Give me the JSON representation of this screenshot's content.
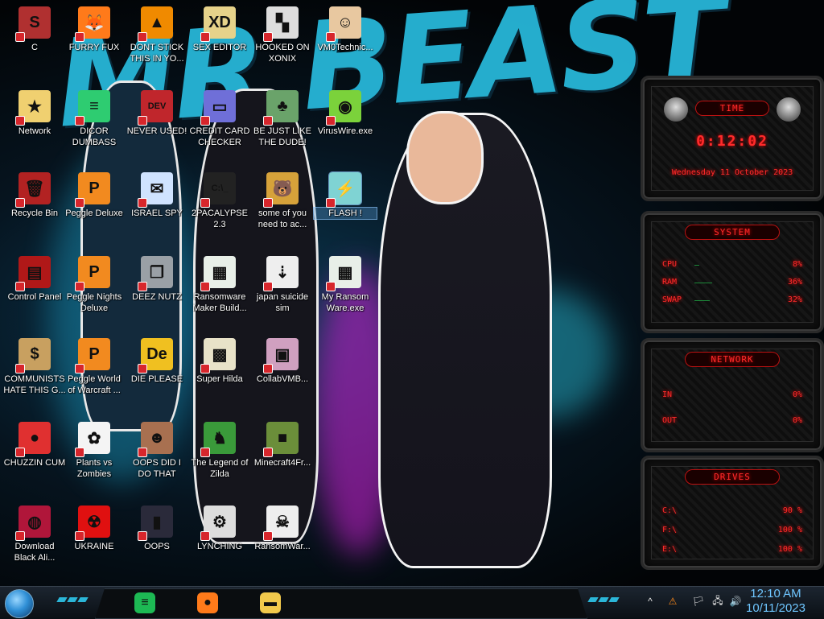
{
  "wallpaper": {
    "text": "MR BEAST"
  },
  "icons": [
    {
      "label": "C",
      "color": "#b03030",
      "glyph": "S"
    },
    {
      "label": "FURRY FUX",
      "color": "#ff7a1a",
      "glyph": "🦊"
    },
    {
      "label": "DONT STICK THIS IN YO...",
      "color": "#f08a00",
      "glyph": "▲"
    },
    {
      "label": "SEX EDITOR",
      "color": "#e6d28a",
      "glyph": "XD"
    },
    {
      "label": "HOOKED ON XONIX",
      "color": "#dddddd",
      "glyph": "▚"
    },
    {
      "label": "VM0Technic...",
      "color": "#e8c8a0",
      "glyph": "☺"
    },
    {
      "label": "Network",
      "color": "#f0d070",
      "glyph": "★"
    },
    {
      "label": "DICOR DUMBASS",
      "color": "#2ecc71",
      "glyph": "≡"
    },
    {
      "label": "NEVER USED!",
      "color": "#c0262c",
      "glyph": "DEV"
    },
    {
      "label": "CREDIT CARD CHECKER",
      "color": "#6f6fd8",
      "glyph": "▭"
    },
    {
      "label": "BE JUST LIKE THE DUDE!",
      "color": "#6aa36a",
      "glyph": "♣"
    },
    {
      "label": "VirusWire.exe",
      "color": "#7bd23b",
      "glyph": "◉"
    },
    {
      "label": "Recycle Bin",
      "color": "#b22222",
      "glyph": "🗑"
    },
    {
      "label": "Peggle Deluxe",
      "color": "#f28a1f",
      "glyph": "P"
    },
    {
      "label": "ISRAEL SPY",
      "color": "#cfe3ff",
      "glyph": "✉"
    },
    {
      "label": "2PACALYPSE 2.3",
      "color": "#222222",
      "glyph": "C:\\_"
    },
    {
      "label": "some of you need to ac...",
      "color": "#d6a23a",
      "glyph": "🐻"
    },
    {
      "label": "FLASH !",
      "color": "#7fd3d3",
      "glyph": "⚡"
    },
    {
      "label": "Control Panel",
      "color": "#b01818",
      "glyph": "▤"
    },
    {
      "label": "Peggle Nights Deluxe",
      "color": "#f28a1f",
      "glyph": "P"
    },
    {
      "label": "DEEZ NUTZ",
      "color": "#9aa0a6",
      "glyph": "❐"
    },
    {
      "label": "Ransomware Maker Build...",
      "color": "#e8efe8",
      "glyph": "▦"
    },
    {
      "label": "japan suicide sim",
      "color": "#eeeeee",
      "glyph": "⇣"
    },
    {
      "label": "My Ransom Ware.exe",
      "color": "#e8efe8",
      "glyph": "▦"
    },
    {
      "label": "COMMUNISTS HATE THIS G...",
      "color": "#c8a060",
      "glyph": "$"
    },
    {
      "label": "Peggle World of Warcraft ...",
      "color": "#f28a1f",
      "glyph": "P"
    },
    {
      "label": "DIE PLEASE",
      "color": "#f0c020",
      "glyph": "De"
    },
    {
      "label": "Super Hilda",
      "color": "#e8e2c8",
      "glyph": "▩"
    },
    {
      "label": "CollabVMB...",
      "color": "#d0a0c0",
      "glyph": "▣"
    },
    {
      "label": "CHUZZIN CUM",
      "color": "#e03030",
      "glyph": "●"
    },
    {
      "label": "Plants vs Zombies",
      "color": "#f4f4f4",
      "glyph": "✿"
    },
    {
      "label": "OOPS DID I DO THAT",
      "color": "#a87050",
      "glyph": "☻"
    },
    {
      "label": "The Legend of Zilda",
      "color": "#3a9a3a",
      "glyph": "♞"
    },
    {
      "label": "Minecraft4Fr...",
      "color": "#6b8e3a",
      "glyph": "■"
    },
    {
      "label": "Download Black Ali...",
      "color": "#b0163a",
      "glyph": "◍"
    },
    {
      "label": "UKRAINE",
      "color": "#e01010",
      "glyph": "☢"
    },
    {
      "label": "OOPS",
      "color": "#2a2a3a",
      "glyph": "▮"
    },
    {
      "label": "LYNCHING",
      "color": "#dddddd",
      "glyph": "⚙"
    },
    {
      "label": "RansomWar...",
      "color": "#eeeeee",
      "glyph": "☠"
    }
  ],
  "gadgets": {
    "time": {
      "header": "TIME",
      "clock": "0:12:02",
      "date": "Wednesday 11 October 2023"
    },
    "system": {
      "header": "SYSTEM",
      "rows": [
        {
          "label": "CPU",
          "value": "8%",
          "level": 0.08
        },
        {
          "label": "RAM",
          "value": "36%",
          "level": 0.36
        },
        {
          "label": "SWAP",
          "value": "32%",
          "level": 0.32
        }
      ]
    },
    "network": {
      "header": "NETWORK",
      "rows": [
        {
          "label": "IN",
          "value": "0%"
        },
        {
          "label": "OUT",
          "value": "0%"
        }
      ]
    },
    "drives": {
      "header": "DRIVES",
      "rows": [
        {
          "label": "C:\\",
          "value": "90 %"
        },
        {
          "label": "F:\\",
          "value": "100 %"
        },
        {
          "label": "E:\\",
          "value": "100 %"
        }
      ]
    }
  },
  "taskbar": {
    "pinned": [
      {
        "name": "spotify",
        "glyph": "≡",
        "color": "#1db954"
      },
      {
        "name": "firefox",
        "glyph": "●",
        "color": "#ff7a1a"
      },
      {
        "name": "explorer",
        "glyph": "▬",
        "color": "#f2c94c"
      }
    ],
    "tray": [
      "^",
      "⚠",
      "🏳",
      "🖧",
      "🔊"
    ],
    "time": "12:10 AM",
    "date": "10/11/2023"
  }
}
